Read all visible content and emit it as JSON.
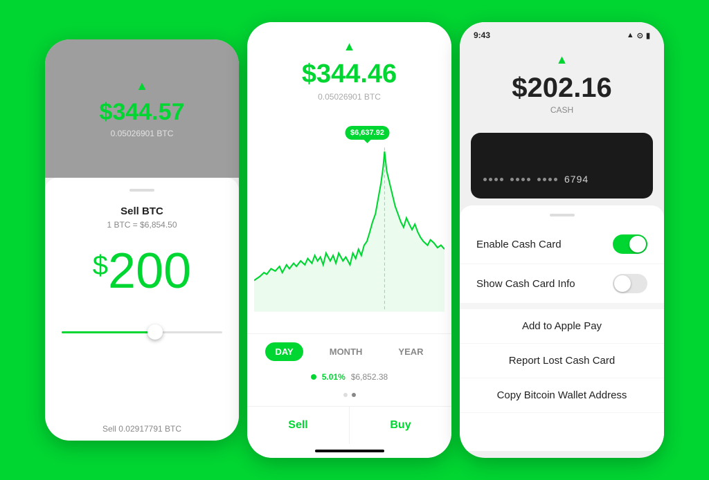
{
  "background_color": "#00D632",
  "screen1": {
    "balance_usd": "$344.57",
    "balance_btc": "0.05026901 BTC",
    "sheet": {
      "title": "Sell BTC",
      "rate": "1 BTC = $6,854.50",
      "amount": "$200",
      "btc_label": "Sell 0.02917791 BTC"
    }
  },
  "screen2": {
    "balance_usd": "$344.46",
    "balance_btc": "0.05026901 BTC",
    "chart": {
      "tooltip": "$6,637.92",
      "time_tabs": [
        "DAY",
        "MONTH",
        "YEAR"
      ],
      "active_tab": "DAY",
      "stat_percent": "5.01%",
      "stat_price": "$6,852.38"
    },
    "sell_label": "Sell",
    "buy_label": "Buy"
  },
  "screen3": {
    "status_bar": {
      "time": "9:43",
      "icons": "▲ ◀ WiFi Battery"
    },
    "balance_usd": "$202.16",
    "balance_label": "CASH",
    "card_number": "6794",
    "actions": {
      "enable_cash_card": "Enable Cash Card",
      "enable_toggle": true,
      "show_cash_card_info": "Show Cash Card Info",
      "show_toggle": false,
      "add_apple_pay": "Add to Apple Pay",
      "report_lost": "Report Lost Cash Card",
      "copy_bitcoin": "Copy Bitcoin Wallet Address"
    }
  }
}
